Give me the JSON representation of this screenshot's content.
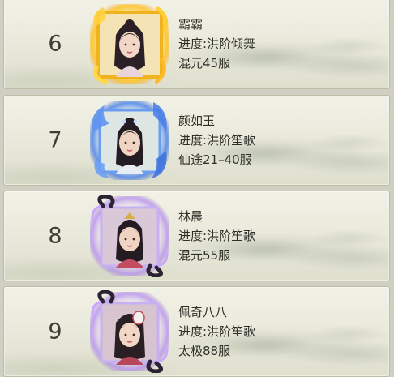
{
  "ranking": {
    "rows": [
      {
        "rank": "6",
        "name": "霸霸",
        "progress": "进度:洪阶倾舞",
        "server": "混元45服",
        "frame_style": "gold-flame",
        "frame_color": "#f2b21c"
      },
      {
        "rank": "7",
        "name": "颜如玉",
        "progress": "进度:洪阶笙歌",
        "server": "仙途21–40服",
        "frame_style": "blue-flame",
        "frame_color": "#4f86e8"
      },
      {
        "rank": "8",
        "name": "林晨",
        "progress": "进度:洪阶笙歌",
        "server": "混元55服",
        "frame_style": "purple-swirl",
        "frame_color": "#9b6fe0"
      },
      {
        "rank": "9",
        "name": "佩奇八八",
        "progress": "进度:洪阶笙歌",
        "server": "太极88服",
        "frame_style": "purple-swirl",
        "frame_color": "#9b6fe0"
      }
    ]
  }
}
